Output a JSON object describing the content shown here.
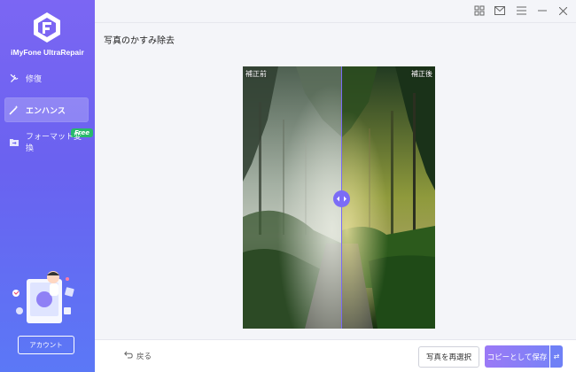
{
  "app": {
    "name": "iMyFone UltraRepair"
  },
  "sidebar": {
    "items": [
      {
        "label": "修復",
        "icon": "wrench-icon"
      },
      {
        "label": "エンハンス",
        "icon": "magic-wand-icon",
        "active": true
      },
      {
        "label": "フォーマット変換",
        "icon": "folder-convert-icon",
        "badge": "Free"
      }
    ],
    "account_label": "アカウント"
  },
  "window_controls": [
    "grid-icon",
    "mail-icon",
    "menu-icon",
    "minimize-icon",
    "close-icon"
  ],
  "main": {
    "title": "写真のかすみ除去",
    "compare": {
      "before_label": "補正前",
      "after_label": "補正後",
      "split_percent": 51.6
    }
  },
  "footer": {
    "back_label": "戻る",
    "reselect_label": "写真を再選択",
    "save_label": "コピーとして保存"
  },
  "colors": {
    "accent": "#7b6cf6",
    "sidebar_top": "#7b66f3",
    "sidebar_bottom": "#5b78f6",
    "free_badge": "#29b96b"
  }
}
